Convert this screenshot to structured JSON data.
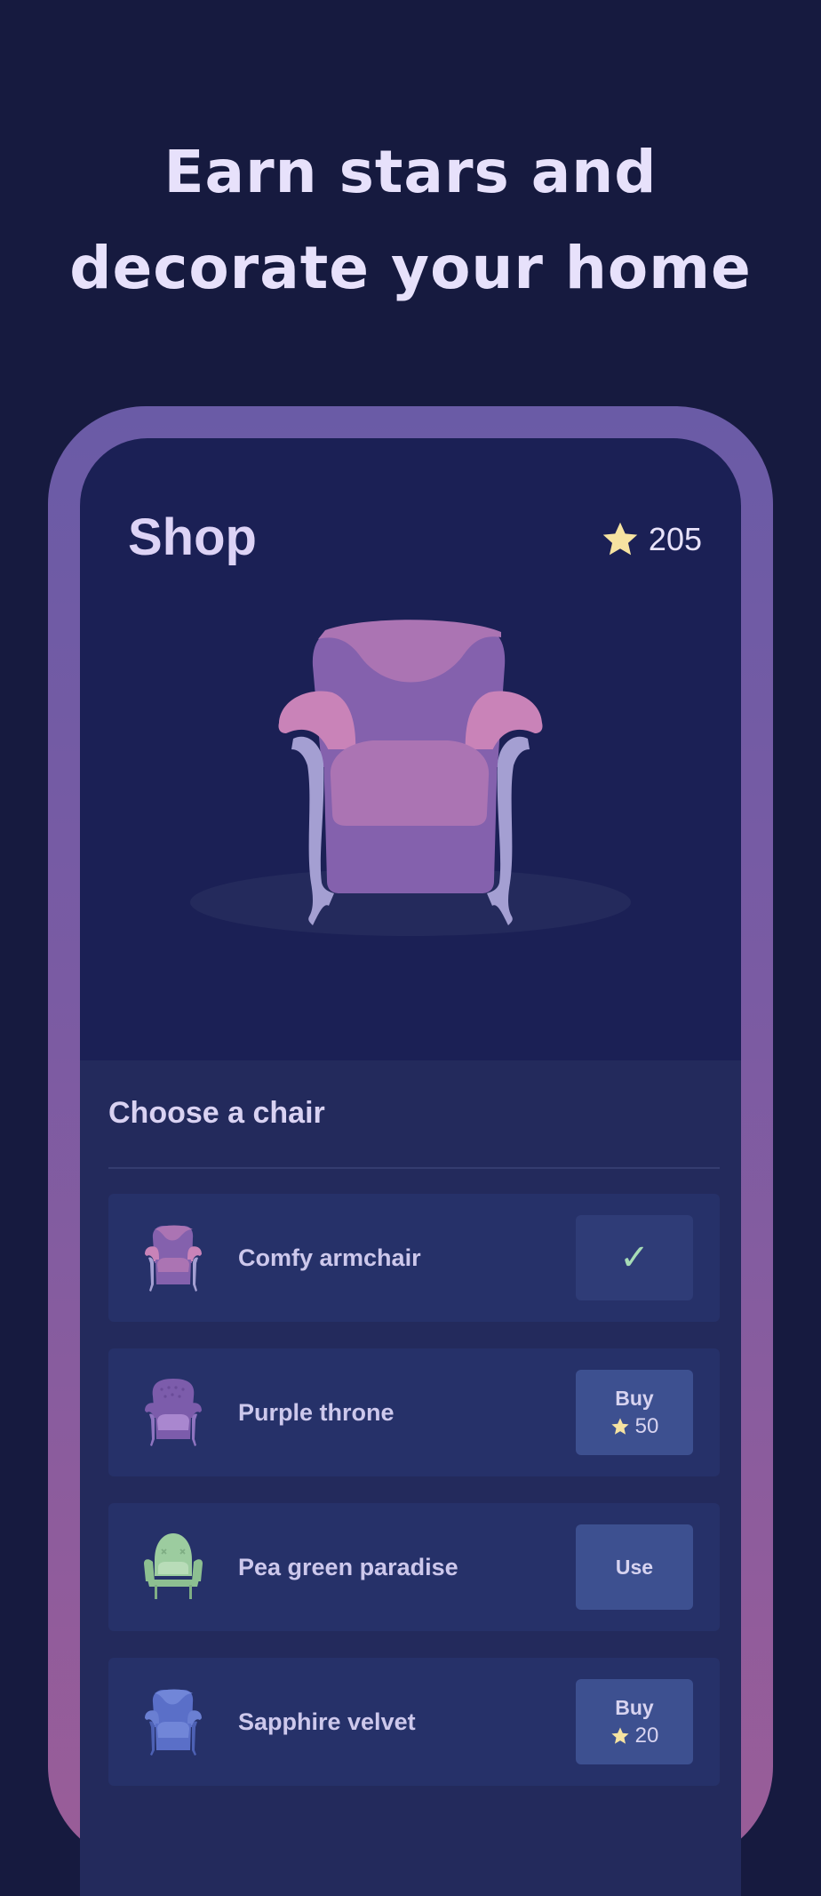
{
  "headline": {
    "line1": "Earn stars and",
    "line2": "decorate your home"
  },
  "shop": {
    "title": "Shop",
    "star_balance": "205"
  },
  "chooser": {
    "title": "Choose a chair",
    "items": [
      {
        "name": "Comfy armchair",
        "action": "✓",
        "state": "selected"
      },
      {
        "name": "Purple throne",
        "action": "Buy",
        "price": "50",
        "state": "buy"
      },
      {
        "name": "Pea green paradise",
        "action": "Use",
        "state": "owned"
      },
      {
        "name": "Sapphire velvet",
        "action": "Buy",
        "price": "20",
        "state": "buy"
      }
    ]
  },
  "colors": {
    "background": "#161a3f",
    "frame_top": "#6a5ba6",
    "frame_bottom": "#9a5d98",
    "screen": "#1b2055",
    "panel": "#232a5c",
    "button": "#3d5090",
    "star": "#f6e3a1",
    "check": "#a7dcb6"
  },
  "icons": {
    "star": "star-icon",
    "check": "checkmark-icon"
  }
}
